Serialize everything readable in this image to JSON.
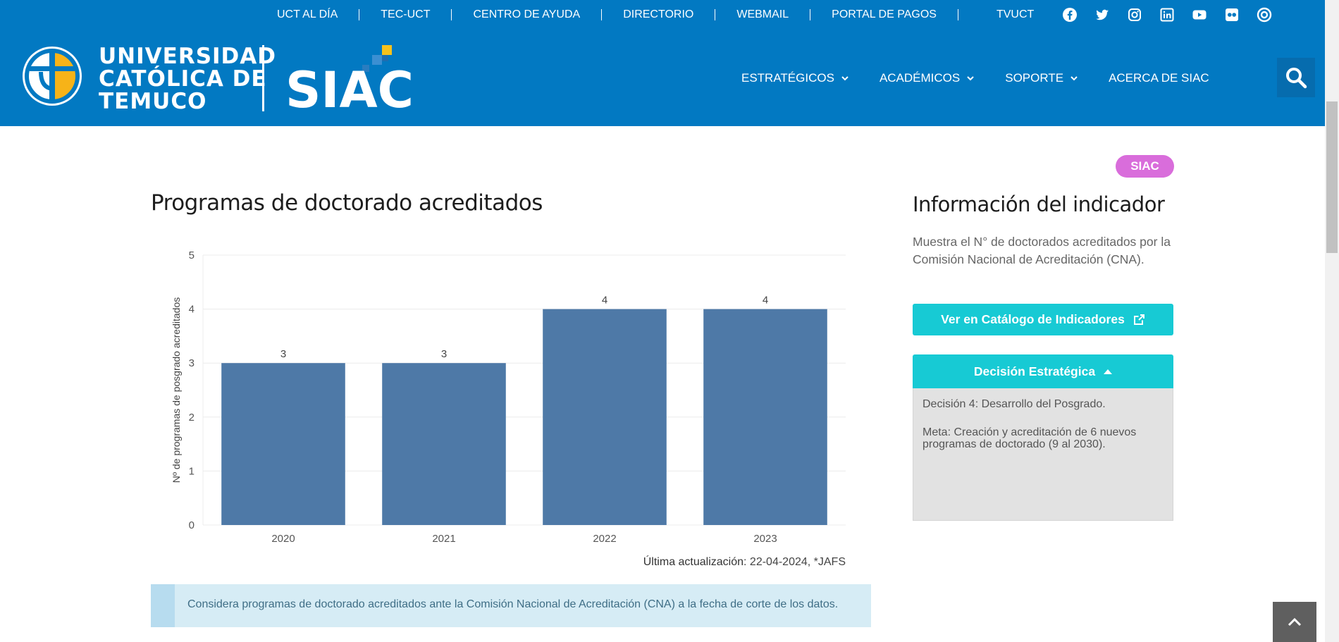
{
  "topbar": {
    "links": [
      "UCT AL DÍA",
      "TEC-UCT",
      "CENTRO DE AYUDA",
      "DIRECTORIO",
      "WEBMAIL",
      "PORTAL DE PAGOS",
      "TVUCT"
    ],
    "social_icons": [
      "facebook-icon",
      "twitter-icon",
      "instagram-icon",
      "linkedin-icon",
      "youtube-icon",
      "flickr-icon",
      "issuu-icon"
    ]
  },
  "header": {
    "university_name": [
      "UNIVERSIDAD",
      "CATÓLICA DE",
      "TEMUCO"
    ],
    "siac_logo_text": "SIAC",
    "nav": [
      "ESTRATÉGICOS",
      "ACADÉMICOS",
      "SOPORTE",
      "ACERCA DE SIAC"
    ],
    "brand_color": "#0279c2"
  },
  "badge": "SIAC",
  "main": {
    "title": "Programas de doctorado acreditados",
    "updated_label": "Última actualización",
    "updated_value": ": 22-04-2024, *JAFS",
    "note": "Considera programas de doctorado acreditados ante la Comisión Nacional de Acreditación (CNA) a la fecha de corte de los datos."
  },
  "sidebar": {
    "title": "Información del indicador",
    "description": "Muestra el N° de doctorados acreditados por la Comisión Nacional de Acreditación (CNA).",
    "catalog_button": "Ver en Catálogo de Indicadores",
    "accordion_title": "Decisión Estratégica",
    "decision": "Decisión 4: Desarrollo del Posgrado.",
    "goal": "Meta: Creación y acreditación de 6 nuevos programas de doctorado (9 al 2030)."
  },
  "chart_data": {
    "type": "bar",
    "categories": [
      "2020",
      "2021",
      "2022",
      "2023"
    ],
    "values": [
      3,
      3,
      4,
      4
    ],
    "data_labels": [
      "3",
      "3",
      "4",
      "4"
    ],
    "title": "",
    "xlabel": "",
    "ylabel": "Nº de programas de posgrado acreditados",
    "ylim": [
      0,
      5
    ],
    "yticks": [
      "0",
      "1",
      "2",
      "3",
      "4",
      "5"
    ],
    "bar_color": "#4e79a7",
    "grid": true
  }
}
